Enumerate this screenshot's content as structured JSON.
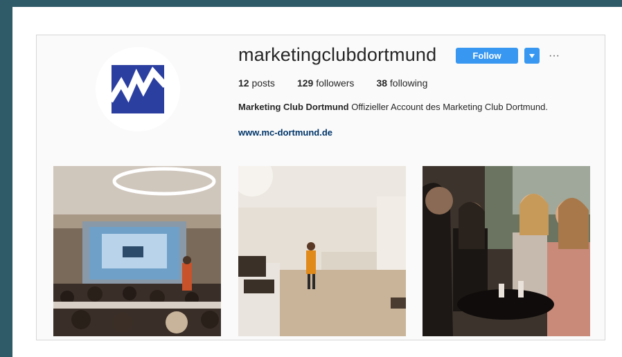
{
  "profile": {
    "username": "marketingclubdortmund",
    "follow_label": "Follow",
    "more_label": "···",
    "stats": {
      "posts": "12",
      "posts_label": "posts",
      "followers": "129",
      "followers_label": "followers",
      "following": "38",
      "following_label": "following"
    },
    "bio_name": "Marketing Club Dortmund",
    "bio_text": " Offizieller Account des Marketing Club Dortmund.",
    "website": "www.mc-dortmund.de"
  },
  "photos": [
    {
      "name": "photo-presentation-room"
    },
    {
      "name": "photo-speaker-hall"
    },
    {
      "name": "photo-networking-women"
    }
  ],
  "colors": {
    "accent": "#3897f0",
    "border": "#2f5a68",
    "logo_blue": "#2b3fa0"
  },
  "icons": {
    "logo": "mc-dortmund-logo",
    "dropdown": "chevron-down-icon"
  }
}
